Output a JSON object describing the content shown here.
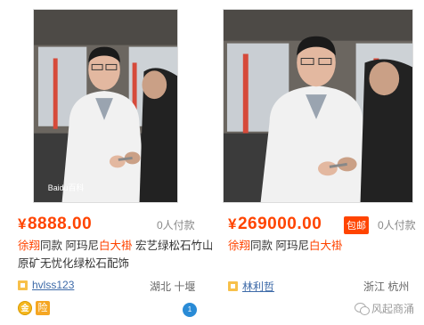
{
  "listings": [
    {
      "price_currency": "¥",
      "price": "8888.00",
      "badge": "",
      "buyers": "0人付款",
      "title_plain_1": "徐翔",
      "title_black_1": "同款 阿玛尼",
      "title_plain_2": "白大褂",
      "title_black_2": " 宏艺绿松石竹山原矿无忧化绿松石配饰",
      "seller": "hvlss123",
      "location": "湖北 十堰",
      "photo_watermark": "Baidu百科"
    },
    {
      "price_currency": "¥",
      "price": "269000.00",
      "badge": "包邮",
      "buyers": "0人付款",
      "title_plain_1": "徐翔",
      "title_black_1": "同款 阿玛尼",
      "title_plain_2": "白大褂",
      "title_black_2": "",
      "seller": "林利哲",
      "location": "浙江 杭州",
      "photo_watermark": ""
    }
  ],
  "bottom_icons": [
    "coin-icon",
    "guarantee-icon"
  ],
  "guarantee_label": "险",
  "coin_label": "金",
  "wangwang_label": "1",
  "watermark_text": "风起商涌",
  "colors": {
    "price": "#ff4400",
    "seller": "#3d6aa8",
    "badge": "#ff4400"
  }
}
